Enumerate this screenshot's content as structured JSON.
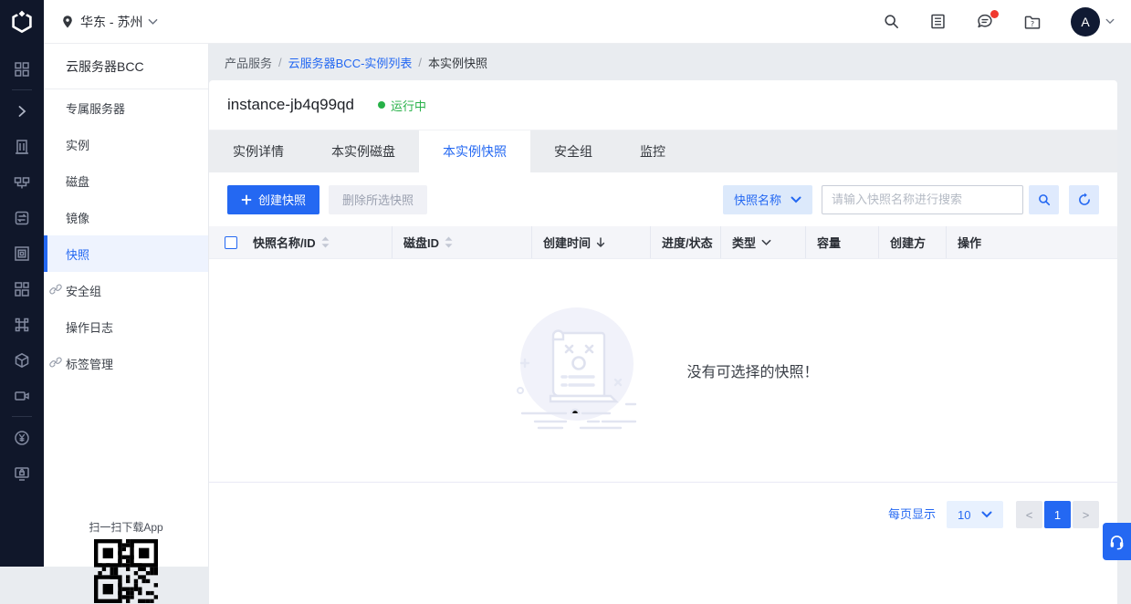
{
  "colors": {
    "primary": "#2468f2",
    "green_running": "#27b148",
    "red_badge": "#f0392f",
    "rail_bg": "#10172a",
    "page_bg": "#e9ecf0"
  },
  "topbar": {
    "region": "华东 - 苏州",
    "region_icon": "location-pin-icon",
    "right_icons": [
      "search-icon",
      "console-doc-icon",
      "message-icon",
      "help-folder-icon"
    ],
    "message_badge": true,
    "avatar_letter": "A"
  },
  "rail": {
    "icons": [
      "apps-grid-icon",
      "chevron-right-icon",
      "building-icon",
      "network-icon",
      "disk-server-icon",
      "frame-icon",
      "grid-alt-icon",
      "command-icon",
      "cube-icon",
      "camera-icon",
      "yen-circle-icon",
      "monitor-lock-icon"
    ]
  },
  "sidebar": {
    "title": "云服务器BCC",
    "items": [
      {
        "label": "专属服务器",
        "active": false,
        "link": false
      },
      {
        "label": "实例",
        "active": false,
        "link": false
      },
      {
        "label": "磁盘",
        "active": false,
        "link": false
      },
      {
        "label": "镜像",
        "active": false,
        "link": false
      },
      {
        "label": "快照",
        "active": true,
        "link": false
      },
      {
        "label": "安全组",
        "active": false,
        "link": true
      },
      {
        "label": "操作日志",
        "active": false,
        "link": false
      },
      {
        "label": "标签管理",
        "active": false,
        "link": true
      }
    ],
    "qr_caption": "扫一扫下载App"
  },
  "breadcrumb": {
    "separator": "/",
    "items": [
      {
        "label": "产品服务",
        "type": "plain"
      },
      {
        "label": "云服务器BCC-实例列表",
        "type": "link"
      },
      {
        "label": "本实例快照",
        "type": "current"
      }
    ]
  },
  "instance": {
    "name": "instance-jb4q99qd",
    "status": "运行中"
  },
  "tabs": [
    {
      "label": "实例详情",
      "active": false
    },
    {
      "label": "本实例磁盘",
      "active": false
    },
    {
      "label": "本实例快照",
      "active": true
    },
    {
      "label": "安全组",
      "active": false
    },
    {
      "label": "监控",
      "active": false
    }
  ],
  "toolbar": {
    "create_label": "创建快照",
    "delete_label": "删除所选快照",
    "filter_field": "快照名称",
    "search_placeholder": "请输入快照名称进行搜索"
  },
  "table": {
    "columns": [
      {
        "label": "快照名称/ID",
        "sort": "both",
        "checkbox": true
      },
      {
        "label": "磁盘ID",
        "sort": "both"
      },
      {
        "label": "创建时间",
        "sort": "down"
      },
      {
        "label": "进度/状态"
      },
      {
        "label": "类型",
        "filter": true
      },
      {
        "label": "容量"
      },
      {
        "label": "创建方"
      },
      {
        "label": "操作"
      }
    ],
    "empty_text": "没有可选择的快照！"
  },
  "pagination": {
    "per_page_label": "每页显示",
    "per_page_value": "10",
    "prev": "<",
    "current_page": "1",
    "next": ">"
  }
}
